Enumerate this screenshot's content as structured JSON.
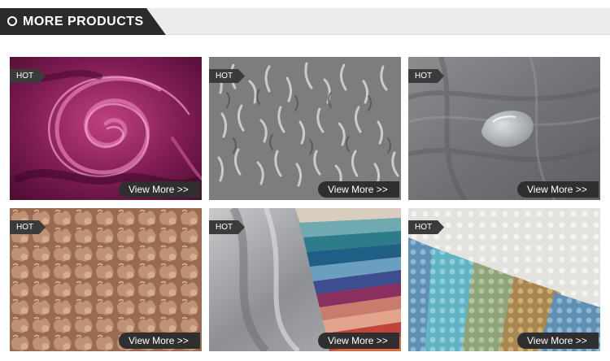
{
  "header": {
    "title": "MORE PRODUCTS"
  },
  "products": [
    {
      "badge": "HOT",
      "button": "View More >>",
      "image": "purple-velvet-swirl"
    },
    {
      "badge": "HOT",
      "button": "View More >>",
      "image": "grey-shaggy-fur"
    },
    {
      "badge": "HOT",
      "button": "View More >>",
      "image": "grey-waterproof-fabric"
    },
    {
      "badge": "HOT",
      "button": "View More >>",
      "image": "tan-sherpa-fleece"
    },
    {
      "badge": "HOT",
      "button": "View More >>",
      "image": "velvet-color-swatches"
    },
    {
      "badge": "HOT",
      "button": "View More >>",
      "image": "minky-dot-fabric"
    }
  ],
  "colors": {
    "header_tab": "#2b2b2b",
    "header_bar": "#ececec",
    "badge": "#3b3b3b",
    "button": "#2f2f2f"
  }
}
